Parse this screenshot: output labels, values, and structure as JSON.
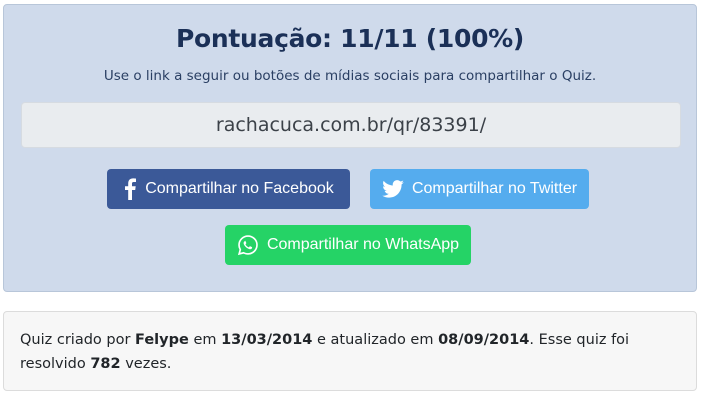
{
  "result": {
    "score_title": "Pontuação: 11/11 (100%)",
    "share_hint": "Use o link a seguir ou botões de mídias sociais para compartilhar o Quiz.",
    "share_link": "rachacuca.com.br/qr/83391/"
  },
  "share_buttons": {
    "facebook": {
      "label": "Compartilhar no Facebook",
      "icon": "facebook-icon",
      "color": "#3b5998"
    },
    "twitter": {
      "label": "Compartilhar no Twitter",
      "icon": "twitter-icon",
      "color": "#55acee"
    },
    "whatsapp": {
      "label": "Compartilhar no WhatsApp",
      "icon": "whatsapp-icon",
      "color": "#25d366"
    }
  },
  "quiz_info": {
    "created_by_prefix": "Quiz criado por",
    "author": "Felype",
    "created_on_prefix": "em",
    "created_date": "13/03/2014",
    "updated_prefix": "e atualizado em",
    "updated_date": "08/09/2014",
    "solved_prefix": ". Esse quiz foi resolvido",
    "solved_count": "782",
    "solved_suffix": "vezes."
  },
  "colors": {
    "card_background": "#cfdaeb",
    "title_color": "#1b3057"
  }
}
